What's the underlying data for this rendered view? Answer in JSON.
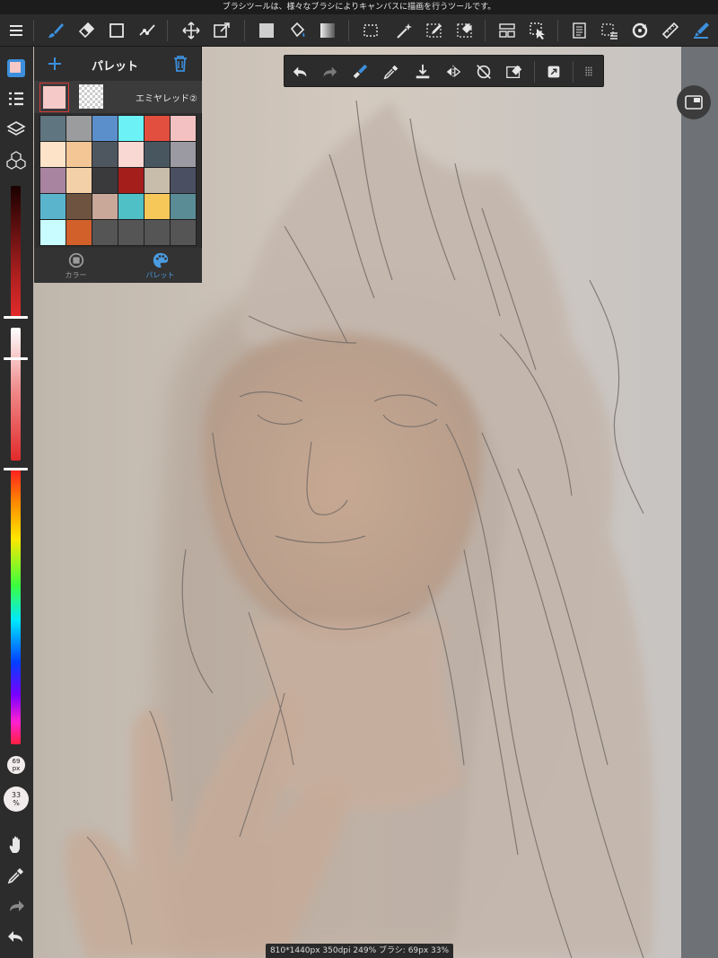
{
  "hint_bar": {
    "text": "ブラシツールは、様々なブラシによりキャンバスに描画を行うツールです。"
  },
  "top_toolbar": {
    "tools": [
      "menu-icon",
      "brush-icon",
      "eraser-icon",
      "shape-icon",
      "edit-icon",
      "move-icon",
      "transform-icon",
      "fill-color-icon",
      "bucket-icon",
      "gradient-icon",
      "select-icon",
      "magic-wand-icon",
      "select-pen-icon",
      "select-eraser-icon",
      "frame-divider-icon",
      "operation-icon",
      "text-layer-icon",
      "dotted-select-icon",
      "rotate-icon",
      "ruler-icon",
      "snap-pen-icon"
    ],
    "accent_color": "#3c8fdc"
  },
  "float_toolbar": {
    "tools": [
      "undo-icon",
      "redo-icon",
      "brush-eraser-icon",
      "eyedropper-icon",
      "import-icon",
      "flip-icon",
      "rotate-off-icon",
      "clear-icon",
      "fullscreen-icon",
      "more-icon"
    ]
  },
  "palette_panel": {
    "title": "パレット",
    "add_label": "+",
    "current_palette_name": "エミヤレッド②",
    "foreground_color": "#f5c9c7",
    "swatches": [
      "#5f7580",
      "#9a9c9d",
      "#5b8fcc",
      "#6cf2f6",
      "#e24f3e",
      "#f4c1c2",
      "#fde3c8",
      "#f4c696",
      "#4e5660",
      "#f9d8d4",
      "#485660",
      "#9b9aa3",
      "#a884a0",
      "#f4d0a8",
      "#3a3a3c",
      "#a41f1c",
      "#c8bcaa",
      "#4a4f62",
      "#5ab4cc",
      "#6e5440",
      "#c9a89a",
      "#4ec0c6",
      "#f6c85a",
      "#5a8c96",
      "#c8fcfe",
      "#d2602a",
      "#555555",
      "#555555",
      "#555555",
      "#555555"
    ],
    "tabs": [
      {
        "label": "カラー",
        "icon": "color-wheel-icon",
        "active": false
      },
      {
        "label": "パレット",
        "icon": "palette-icon",
        "active": true
      }
    ]
  },
  "left_sidebar": {
    "tools": [
      "color-swatch-icon",
      "brush-list-icon",
      "layers-icon",
      "material-icon"
    ],
    "brush_size_label": "69",
    "brush_size_unit": "px",
    "opacity_label": "33",
    "opacity_unit": "%",
    "bottom_tools": [
      "hand-icon",
      "eyedropper-icon",
      "redo-icon",
      "undo-icon"
    ]
  },
  "status": {
    "text": "810*1440px 350dpi 249% ブラシ: 69px 33%"
  }
}
